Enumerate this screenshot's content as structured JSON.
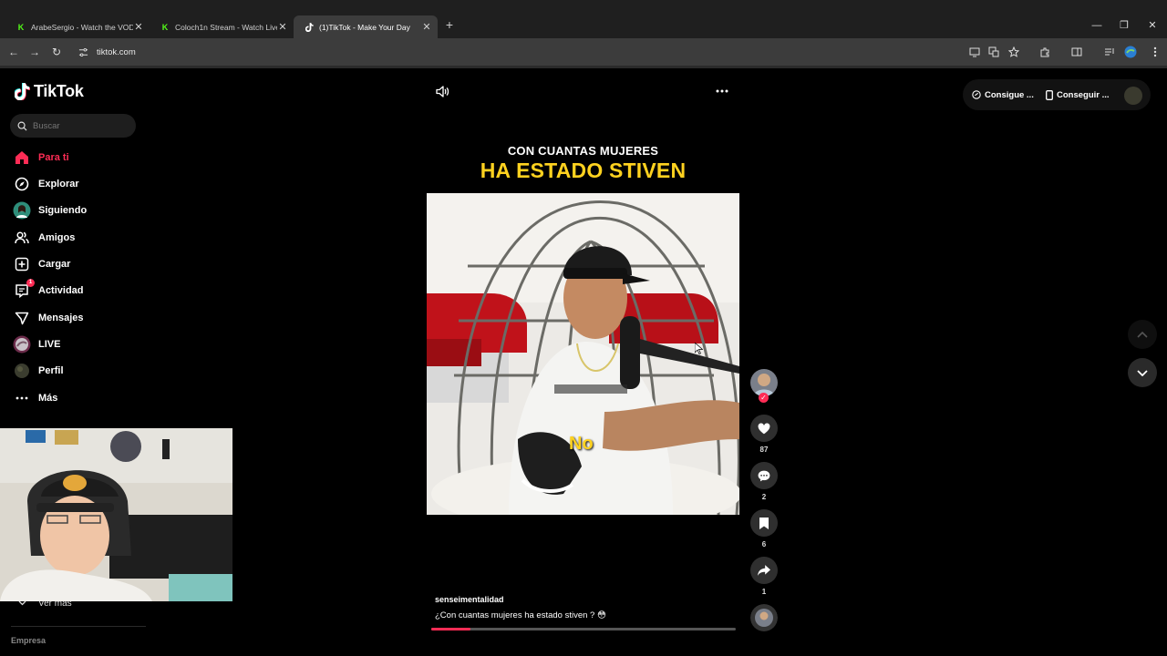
{
  "browser": {
    "tabs": [
      {
        "title": "ArabeSergio - Watch the VOD",
        "favicon": "kick-icon",
        "active": false
      },
      {
        "title": "Coloch1n Stream - Watch Live",
        "favicon": "kick-icon",
        "active": false
      },
      {
        "title": "(1)TikTok - Make Your Day",
        "favicon": "tiktok-icon",
        "active": true
      }
    ],
    "url": "tiktok.com",
    "favicon_letter": "K"
  },
  "sidebar": {
    "logo": "TikTok",
    "search_placeholder": "Buscar",
    "items": [
      {
        "label": "Para ti",
        "icon": "home-icon",
        "active": true
      },
      {
        "label": "Explorar",
        "icon": "compass-icon",
        "active": false
      },
      {
        "label": "Siguiendo",
        "icon": "following-avatar-icon",
        "active": false
      },
      {
        "label": "Amigos",
        "icon": "friends-icon",
        "active": false
      },
      {
        "label": "Cargar",
        "icon": "upload-icon",
        "active": false
      },
      {
        "label": "Actividad",
        "icon": "activity-icon",
        "active": false,
        "badge": "1"
      },
      {
        "label": "Mensajes",
        "icon": "messages-icon",
        "active": false
      },
      {
        "label": "LIVE",
        "icon": "live-icon",
        "active": false
      },
      {
        "label": "Perfil",
        "icon": "profile-avatar-icon",
        "active": false
      },
      {
        "label": "Más",
        "icon": "more-dots-icon",
        "active": false
      }
    ],
    "see_more": "Ver más",
    "footer_partial": "Empresa"
  },
  "video": {
    "title_line1": "CON CUANTAS MUJERES",
    "title_line2": "HA ESTADO STIVEN",
    "subtitle": "No",
    "author": "senseimentalidad",
    "description": "¿Con cuantas mujeres ha estado stiven ?",
    "description_emoji": "😳",
    "progress_fraction": 0.13
  },
  "actions": {
    "likes": "87",
    "comments": "2",
    "saves": "6",
    "shares": "1"
  },
  "header": {
    "get_coins": "Consigue ...",
    "get_app": "Conseguir ..."
  },
  "colors": {
    "accent": "#fe2c55",
    "caption_yellow": "#ffd21f",
    "kick_green": "#53fc18"
  }
}
